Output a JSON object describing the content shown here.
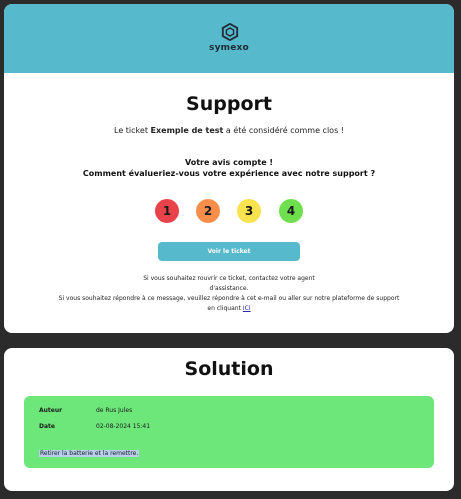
{
  "brand": {
    "name": "symexo",
    "header_color": "#56b9cc"
  },
  "support": {
    "title": "Support",
    "closed_prefix": "Le ticket",
    "ticket_name": "Exemple de test",
    "closed_suffix": "a été considéré comme clos !",
    "feedback_line1": "Votre avis compte !",
    "feedback_line2": "Comment évalueriez-vous votre expérience avec notre support ?",
    "ratings": [
      {
        "label": "1",
        "color": "#e8434b"
      },
      {
        "label": "2",
        "color": "#f98e4b"
      },
      {
        "label": "3",
        "color": "#f8e24e"
      },
      {
        "label": "4",
        "color": "#6ee04e"
      }
    ],
    "view_ticket_label": "Voir le ticket",
    "reopen_line1": "Si vous souhaitez rouvrir ce ticket, contactez votre agent",
    "reopen_line2": "d'assistance.",
    "reopen_line3": "Si vous souhaitez répondre à ce message, veuillez répondre à cet e-mail ou aller sur notre plateforme de support",
    "reopen_line4_prefix": "en cliquant",
    "reopen_link_label": "ICI"
  },
  "solution": {
    "title": "Solution",
    "box_color": "#6de77a",
    "author_label": "Auteur",
    "author_value": "de Rus Jules",
    "date_label": "Date",
    "date_value": "02-08-2024 15:41",
    "text": "Retirer la batterie et la remettre."
  }
}
